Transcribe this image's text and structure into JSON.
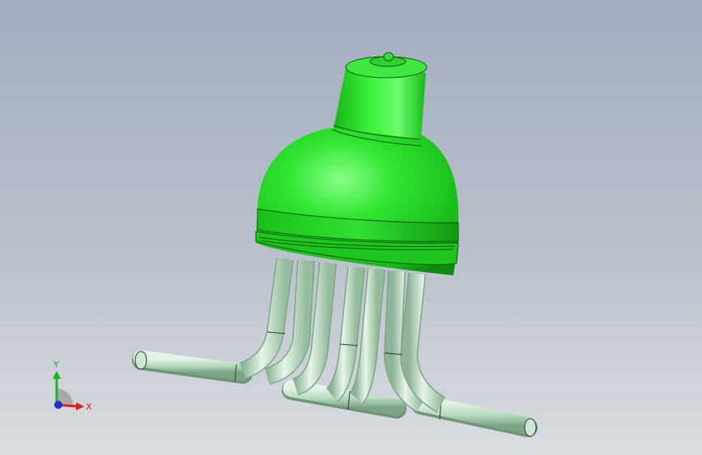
{
  "viewport": {
    "background_top": "#a2adbe",
    "background_bottom": "#dadde1"
  },
  "model": {
    "body_color": "#22dd22",
    "body_highlight": "#7cff7c",
    "body_shadow": "#0f8f0f",
    "pipe_color": "#b9dcc0",
    "pipe_highlight": "#e8f6ea",
    "pipe_shadow": "#7fa588",
    "pipe_count": 8
  },
  "triad": {
    "x_label": "X",
    "y_label": "Y",
    "x_color": "#e02020",
    "y_color": "#20b020",
    "z_color": "#2030d0"
  }
}
